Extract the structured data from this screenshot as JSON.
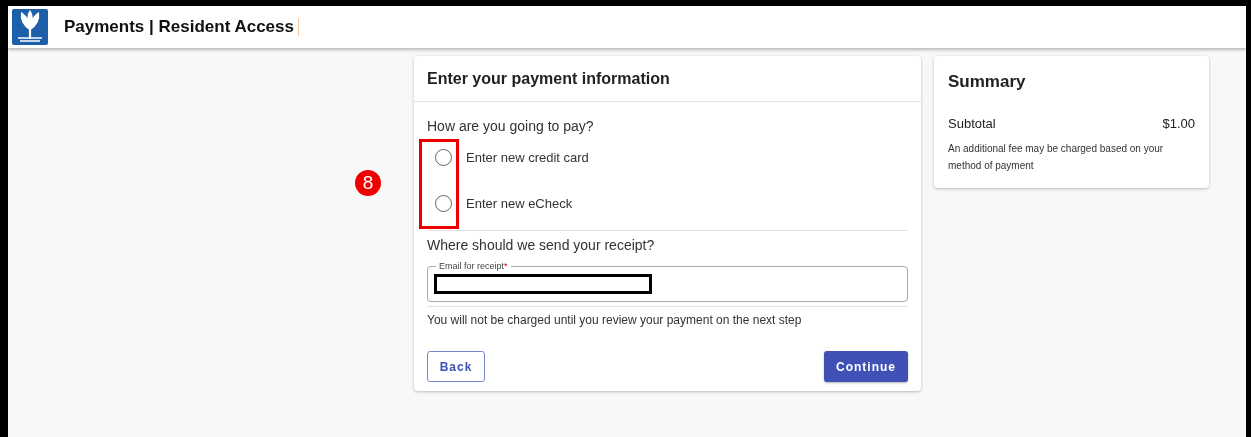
{
  "header": {
    "title": "Payments | Resident Access"
  },
  "payment_card": {
    "title": "Enter your payment information",
    "question": "How are you going to pay?",
    "options": [
      {
        "label": "Enter new credit card",
        "selected": false
      },
      {
        "label": "Enter new eCheck",
        "selected": false
      }
    ],
    "receipt_question": "Where should we send your receipt?",
    "email_field": {
      "label": "Email for receipt",
      "required_mark": "*",
      "redacted": true
    },
    "note": "You will not be charged until you review your payment on the next step",
    "buttons": [
      {
        "label": "Back",
        "kind": "outlined"
      },
      {
        "label": "Continue",
        "kind": "filled"
      }
    ]
  },
  "summary": {
    "title": "Summary",
    "rows": [
      {
        "label": "Subtotal",
        "value": "$1.00"
      }
    ],
    "note": "An additional fee may be charged based on your method of payment"
  },
  "annotation": {
    "step": "8"
  }
}
